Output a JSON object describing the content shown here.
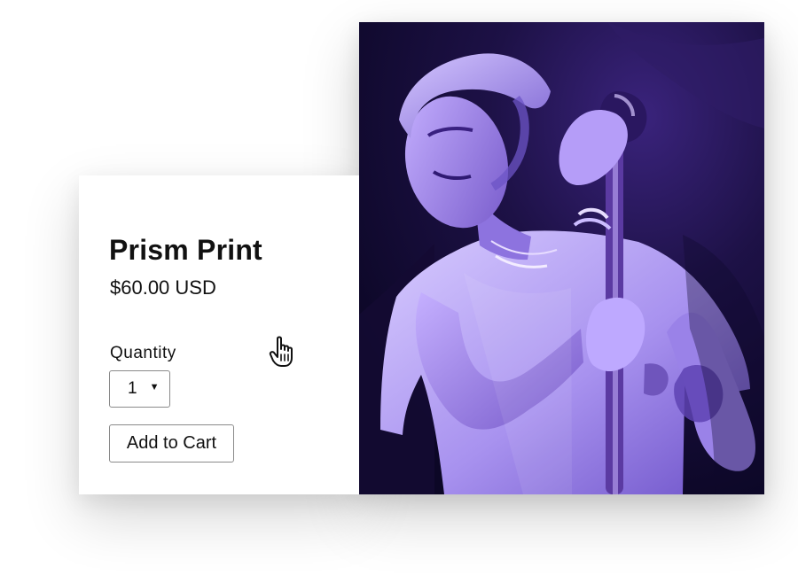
{
  "product": {
    "title": "Prism Print",
    "price": "$60.00 USD",
    "quantity_label": "Quantity",
    "quantity_value": "1",
    "add_to_cart_label": "Add to Cart"
  },
  "image": {
    "subject": "performer-with-microphone-stand",
    "tint_color": "#4b2a91"
  },
  "cursor": {
    "icon": "hand-pointer-icon"
  },
  "colors": {
    "text": "#111111",
    "border": "#8a8a8a",
    "photo_dark": "#150c35",
    "photo_mid": "#5a3aa8",
    "photo_light": "#d7c8ff"
  }
}
